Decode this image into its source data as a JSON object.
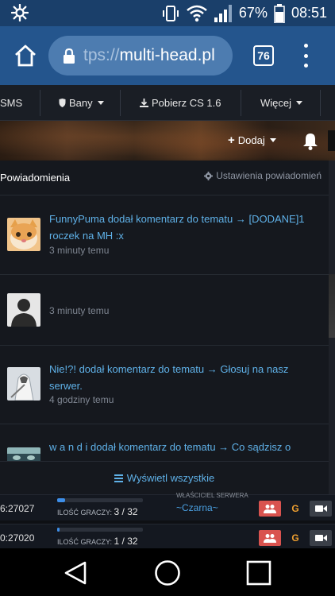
{
  "statusbar": {
    "battery_percent": "67%",
    "time": "08:51",
    "icons": [
      "vibrate-icon",
      "wifi-icon",
      "signal-icon",
      "battery-icon"
    ]
  },
  "browser": {
    "url_dim": "tps://",
    "url_host": "multi-head.pl",
    "tab_count": "76"
  },
  "nav": {
    "items": [
      "SMS",
      "Bany",
      "Pobierz CS 1.6",
      "Więcej"
    ]
  },
  "hero": {
    "add_label": "Dodaj"
  },
  "notifications": {
    "title": "Powiadomienia",
    "settings_label": "Ustawienia powiadomień",
    "items": [
      {
        "text": "FunnyPuma dodał komentarz do tematu → [DODANE]1 roczek na MH :x",
        "time": "3 minuty temu"
      },
      {
        "text": "",
        "time": "3 minuty temu"
      },
      {
        "text": "Nie!?! dodał komentarz do tematu → Głosuj na nasz serwer.",
        "time": "4 godziny temu"
      },
      {
        "text": "w a n d i dodał komentarz do tematu → Co sądzisz o",
        "time": ""
      }
    ],
    "view_all_label": "Wyświetl wszystkie"
  },
  "servers": [
    {
      "ip": "6:27027",
      "players_label": "ILOŚĆ GRACZY:",
      "players": "3 / 32",
      "fill": 0.09,
      "owner_label": "WŁAŚCICIEL SERWERA",
      "owner": "~Czarna~"
    },
    {
      "ip": "0:27020",
      "players_label": "ILOŚĆ GRACZY:",
      "players": "1 / 32",
      "fill": 0.03,
      "owner_label": "",
      "owner": ""
    }
  ],
  "colors": {
    "statusbar": "#1a3f6a",
    "browserbar": "#24558d",
    "link": "#5fb1e8",
    "accent_red": "#d9534f"
  }
}
